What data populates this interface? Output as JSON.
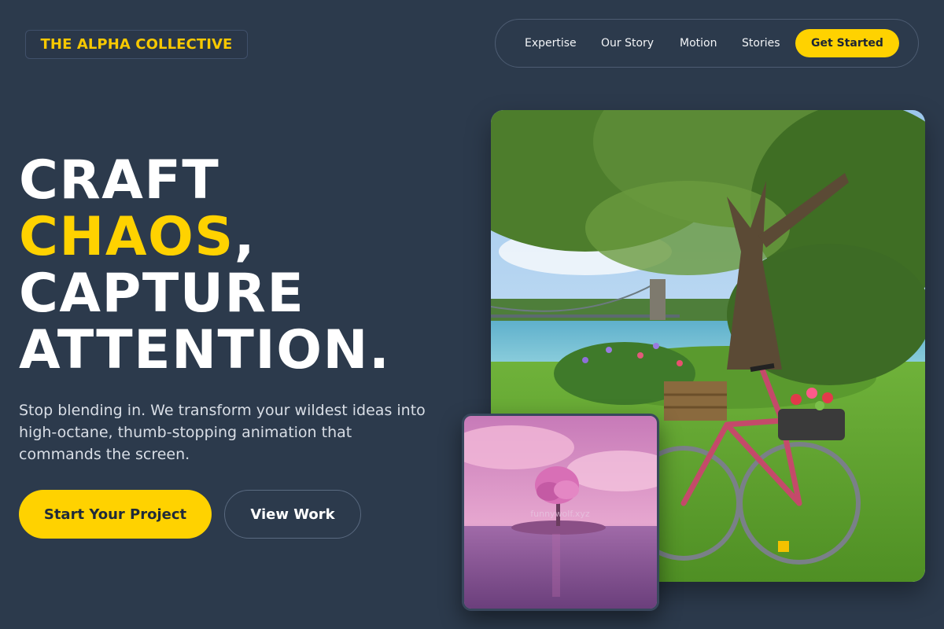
{
  "brand": {
    "name": "THE ALPHA COLLECTIVE"
  },
  "nav": {
    "links": [
      "Expertise",
      "Our Story",
      "Motion",
      "Stories"
    ],
    "cta": "Get Started"
  },
  "hero": {
    "line1": "CRAFT",
    "line2_accent": "CHAOS",
    "line2_rest": ",",
    "line3": "CAPTURE",
    "line4": "ATTENTION.",
    "subtext": "Stop blending in. We transform your wildest ideas into high-octane, thumb-stopping animation that commands the screen.",
    "primary_button": "Start Your Project",
    "secondary_button": "View Work"
  },
  "images": {
    "main_photo": "bicycle-in-park-photo",
    "inset_photo": "pink-tree-island-photo",
    "watermark": "funnywolf.xyz"
  },
  "colors": {
    "background": "#2c3a4c",
    "accent": "#ffd200",
    "text": "#ffffff"
  }
}
